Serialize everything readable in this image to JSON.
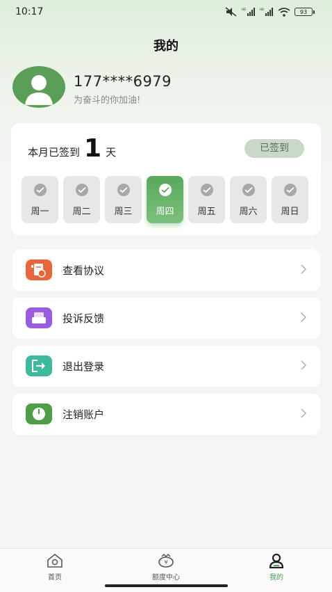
{
  "status_bar": {
    "time": "10:17",
    "battery": "93"
  },
  "header": {
    "title": "我的"
  },
  "profile": {
    "phone": "177****6979",
    "motto": "为奋斗的你加油!"
  },
  "checkin": {
    "prefix": "本月已签到",
    "count": "1",
    "suffix": "天",
    "button_label": "已签到",
    "days": [
      {
        "label": "周一",
        "active": false
      },
      {
        "label": "周二",
        "active": false
      },
      {
        "label": "周三",
        "active": false
      },
      {
        "label": "周四",
        "active": true
      },
      {
        "label": "周五",
        "active": false
      },
      {
        "label": "周六",
        "active": false
      },
      {
        "label": "周日",
        "active": false
      }
    ]
  },
  "menu": {
    "items": [
      {
        "label": "查看协议",
        "icon": "document-icon",
        "color": "#e8663c"
      },
      {
        "label": "投诉反馈",
        "icon": "feedback-icon",
        "color": "#9b5be0"
      },
      {
        "label": "退出登录",
        "icon": "logout-icon",
        "color": "#3fb99b"
      },
      {
        "label": "注销账户",
        "icon": "power-icon",
        "color": "#4f9e45"
      }
    ]
  },
  "tab_bar": {
    "tabs": [
      {
        "label": "首页",
        "icon": "home-icon",
        "active": false
      },
      {
        "label": "额度中心",
        "icon": "quota-icon",
        "active": false
      },
      {
        "label": "我的",
        "icon": "user-icon",
        "active": true
      }
    ]
  },
  "colors": {
    "accent": "#5aa65c",
    "card_bg": "#ffffff",
    "page_bg": "#f4f4f4"
  }
}
